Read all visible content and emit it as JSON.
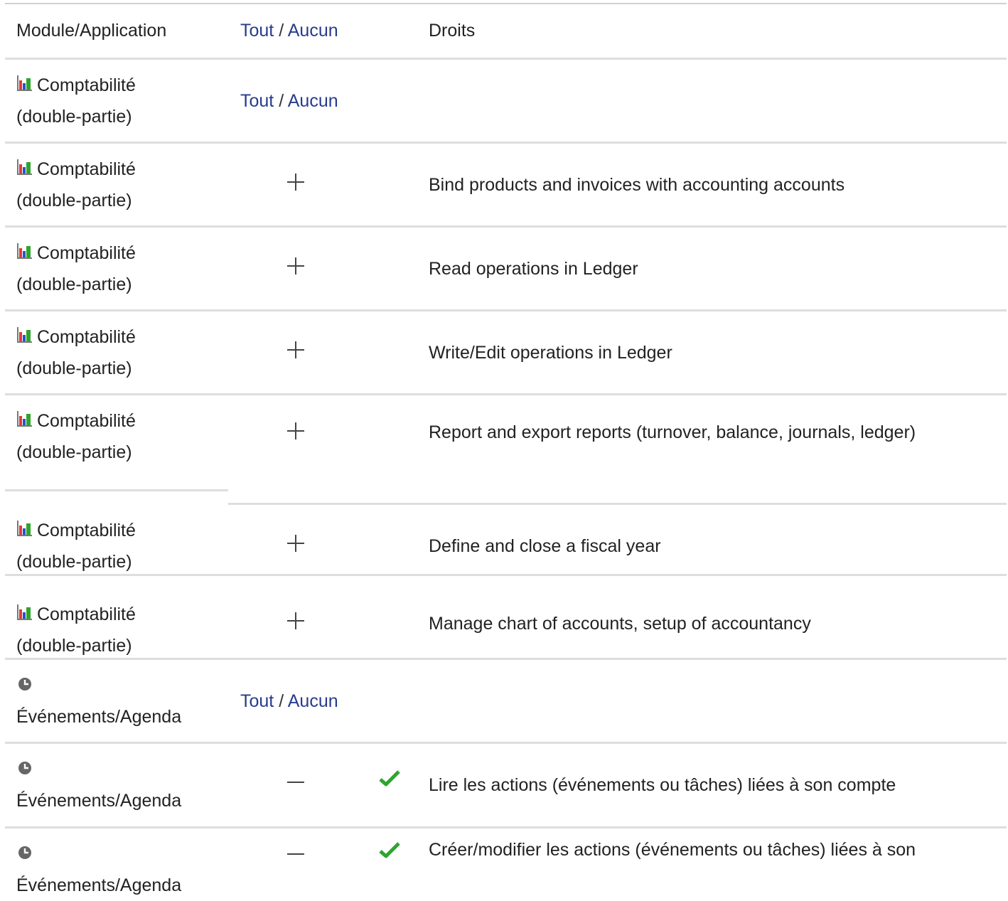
{
  "header": {
    "module": "Module/Application",
    "all": "Tout",
    "sep": "/",
    "none": "Aucun",
    "rights": "Droits"
  },
  "module_accounting": {
    "line1": "Comptabilité",
    "line2": "(double-partie)",
    "icon": "bar-chart-icon"
  },
  "module_agenda": {
    "line1": "Événements/Agenda",
    "icon": "clock-icon"
  },
  "rows": [
    {
      "type": "group",
      "module": "accounting",
      "all": "Tout",
      "sep": "/",
      "none": "Aucun"
    },
    {
      "type": "permission",
      "module": "accounting",
      "toggle": "plus",
      "granted": false,
      "label": "Bind products and invoices with accounting accounts"
    },
    {
      "type": "permission",
      "module": "accounting",
      "toggle": "plus",
      "granted": false,
      "label": "Read operations in Ledger"
    },
    {
      "type": "permission",
      "module": "accounting",
      "toggle": "plus",
      "granted": false,
      "label": "Write/Edit operations in Ledger"
    },
    {
      "type": "permission",
      "module": "accounting",
      "toggle": "plus",
      "granted": false,
      "label": "Report and export reports (turnover, balance, journals, ledger)"
    },
    {
      "type": "permission",
      "module": "accounting",
      "toggle": "plus",
      "granted": false,
      "label": "Define and close a fiscal year"
    },
    {
      "type": "permission",
      "module": "accounting",
      "toggle": "plus",
      "granted": false,
      "label": "Manage chart of accounts, setup of accountancy"
    },
    {
      "type": "group",
      "module": "agenda",
      "all": "Tout",
      "sep": "/",
      "none": "Aucun"
    },
    {
      "type": "permission",
      "module": "agenda",
      "toggle": "minus",
      "granted": true,
      "label": "Lire les actions (événements ou tâches) liées à son compte"
    },
    {
      "type": "permission",
      "module": "agenda",
      "toggle": "minus",
      "granted": true,
      "label": "Créer/modifier les actions (événements ou tâches) liées à son"
    }
  ],
  "colors": {
    "link": "#263c8f",
    "check": "#2ea52e",
    "divider": "#dedede",
    "bar_red": "#e53935",
    "bar_blue": "#2b4fd6",
    "bar_green": "#2ea52e",
    "clock": "#666666"
  }
}
